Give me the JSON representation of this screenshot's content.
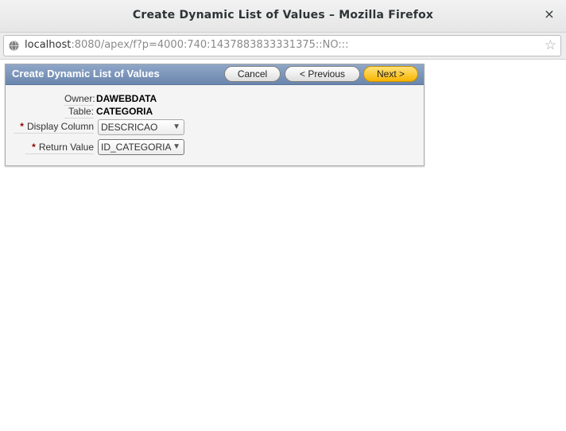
{
  "window": {
    "title": "Create Dynamic List of Values – Mozilla Firefox",
    "close_label": "×"
  },
  "urlbar": {
    "host": "localhost",
    "path": ":8080/apex/f?p=4000:740:1437883833331375::NO:::",
    "icon": "globe-icon",
    "bookmark_icon": "star-icon"
  },
  "region": {
    "title": "Create Dynamic List of Values",
    "buttons": {
      "cancel": "Cancel",
      "previous": "< Previous",
      "next": "Next >"
    }
  },
  "form": {
    "owner_label": "Owner:",
    "owner_value": "DAWEBDATA",
    "table_label": "Table:",
    "table_value": "CATEGORIA",
    "display_label": "Display Column",
    "display_value": "DESCRICAO",
    "return_label": "Return Value",
    "return_value": "ID_CATEGORIA",
    "required_marker": "*"
  },
  "colors": {
    "header_blue": "#7a93b8",
    "next_button": "#f7b500",
    "required": "#8b0000"
  }
}
